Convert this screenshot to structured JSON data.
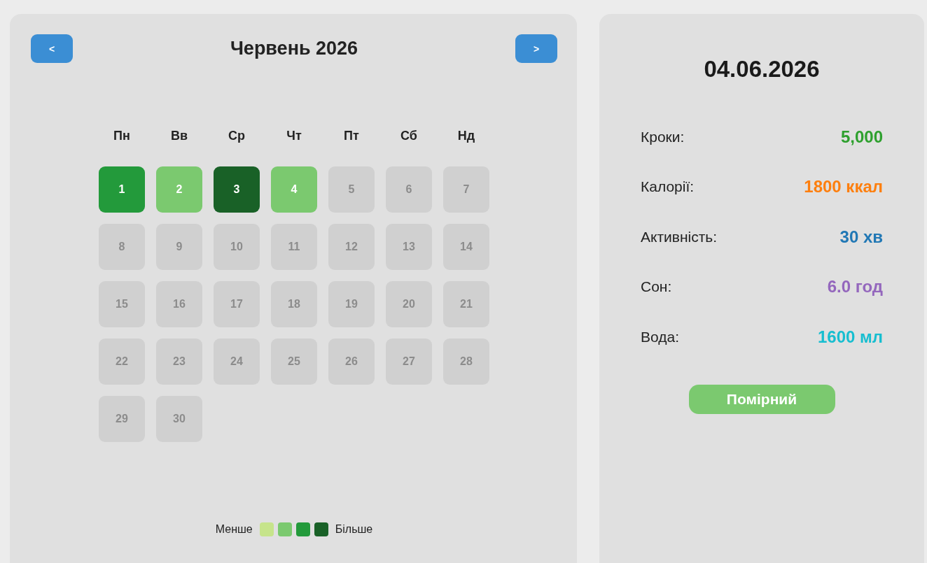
{
  "calendar": {
    "prev_button": "<",
    "title": "Червень 2026",
    "next_button": ">",
    "weekdays": [
      "Пн",
      "Вв",
      "Ср",
      "Чт",
      "Пт",
      "Сб",
      "Нд"
    ],
    "days": [
      {
        "label": "1",
        "color": "#239a3b"
      },
      {
        "label": "2",
        "color": "#7bc96f"
      },
      {
        "label": "3",
        "color": "#196127"
      },
      {
        "label": "4",
        "color": "#7bc96f"
      },
      {
        "label": "5",
        "color": "#d0d0d0"
      },
      {
        "label": "6",
        "color": "#d0d0d0"
      },
      {
        "label": "7",
        "color": "#d0d0d0"
      },
      {
        "label": "8",
        "color": "#d0d0d0"
      },
      {
        "label": "9",
        "color": "#d0d0d0"
      },
      {
        "label": "10",
        "color": "#d0d0d0"
      },
      {
        "label": "11",
        "color": "#d0d0d0"
      },
      {
        "label": "12",
        "color": "#d0d0d0"
      },
      {
        "label": "13",
        "color": "#d0d0d0"
      },
      {
        "label": "14",
        "color": "#d0d0d0"
      },
      {
        "label": "15",
        "color": "#d0d0d0"
      },
      {
        "label": "16",
        "color": "#d0d0d0"
      },
      {
        "label": "17",
        "color": "#d0d0d0"
      },
      {
        "label": "18",
        "color": "#d0d0d0"
      },
      {
        "label": "19",
        "color": "#d0d0d0"
      },
      {
        "label": "20",
        "color": "#d0d0d0"
      },
      {
        "label": "21",
        "color": "#d0d0d0"
      },
      {
        "label": "22",
        "color": "#d0d0d0"
      },
      {
        "label": "23",
        "color": "#d0d0d0"
      },
      {
        "label": "24",
        "color": "#d0d0d0"
      },
      {
        "label": "25",
        "color": "#d0d0d0"
      },
      {
        "label": "26",
        "color": "#d0d0d0"
      },
      {
        "label": "27",
        "color": "#d0d0d0"
      },
      {
        "label": "28",
        "color": "#d0d0d0"
      },
      {
        "label": "29",
        "color": "#d0d0d0"
      },
      {
        "label": "30",
        "color": "#d0d0d0"
      }
    ],
    "legend": {
      "less": "Менше",
      "swatches": [
        {
          "color": "#c6e48b"
        },
        {
          "color": "#7bc96f"
        },
        {
          "color": "#239a3b"
        },
        {
          "color": "#196127"
        }
      ],
      "more": "Більше"
    }
  },
  "details": {
    "date": "04.06.2026",
    "stats": [
      {
        "label": "Кроки:",
        "value": "5,000",
        "color": "#2ea02e"
      },
      {
        "label": "Калорії:",
        "value": "1800 ккал",
        "color": "#fd7f0e"
      },
      {
        "label": "Активність:",
        "value": "30 хв",
        "color": "#2178b5"
      },
      {
        "label": "Сон:",
        "value": "6.0 год",
        "color": "#9467bd"
      },
      {
        "label": "Вода:",
        "value": "1600 мл",
        "color": "#17bed0"
      }
    ],
    "badge": {
      "label": "Помірний",
      "color": "#7bc96f"
    }
  }
}
